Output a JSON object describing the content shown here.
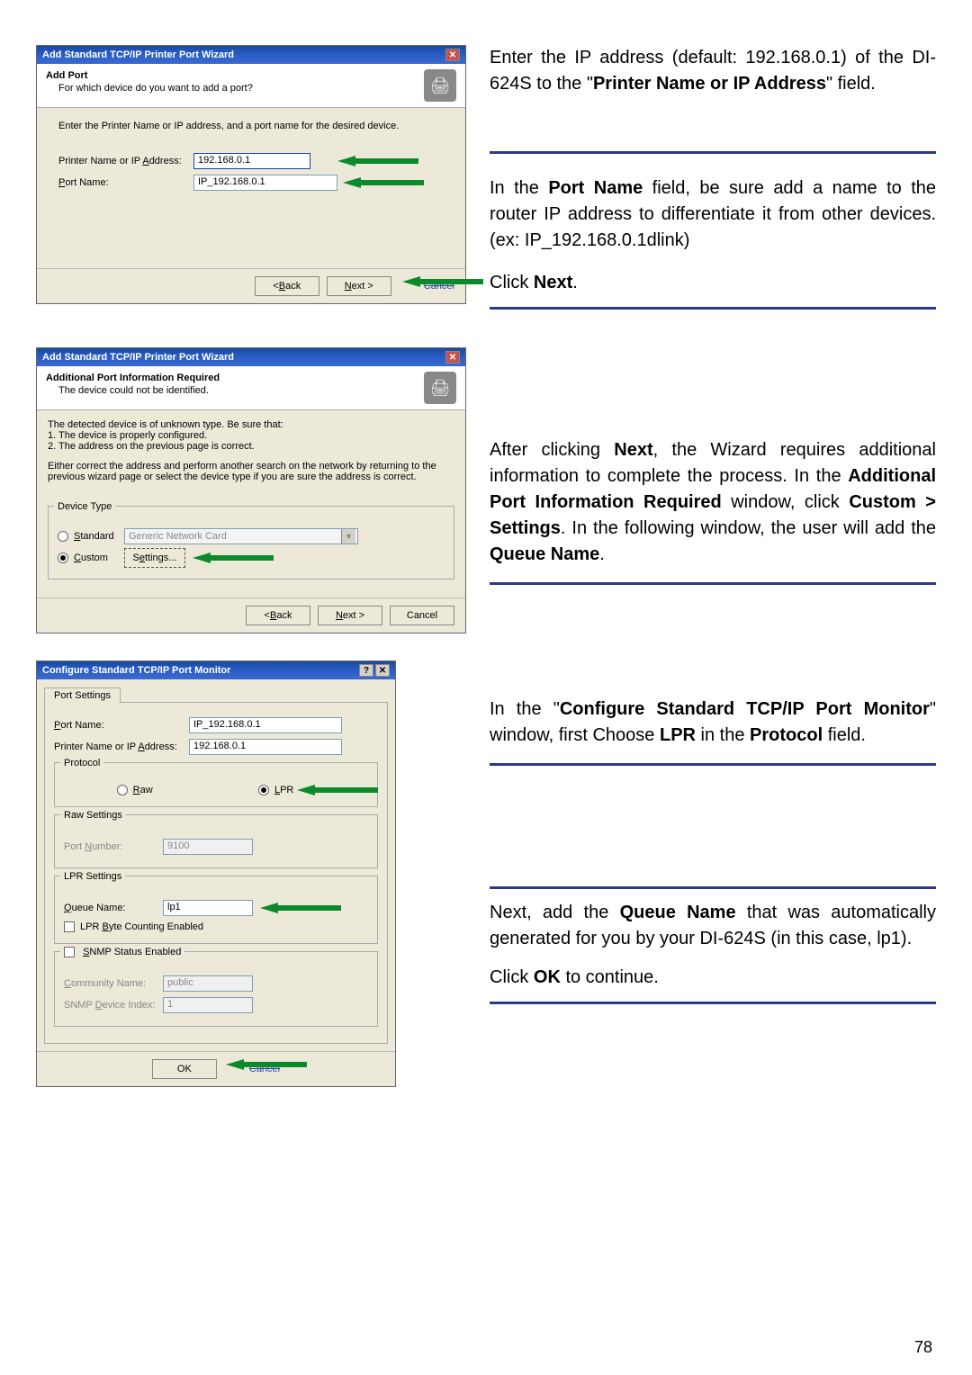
{
  "dialogs": {
    "addPort": {
      "title": "Add Standard TCP/IP Printer Port Wizard",
      "heading": "Add Port",
      "sub": "For which device do you want to add a port?",
      "instruction": "Enter the Printer Name or IP address, and a port name for the desired device.",
      "field1Label": "Printer Name or IP Address:",
      "field1Value": "192.168.0.1",
      "field2Label": "Port Name:",
      "field2Value": "IP_192.168.0.1",
      "backBtn": "< Back",
      "nextBtn": "Next >",
      "cancelBtn": "Cancel"
    },
    "additional": {
      "title": "Add Standard TCP/IP Printer Port Wizard",
      "heading": "Additional Port Information Required",
      "sub": "The device could not be identified.",
      "body1": "The detected device is of unknown type.  Be sure that:",
      "body2": "1. The device is properly configured.",
      "body3": "2.  The address on the previous page is correct.",
      "body4": "Either correct the address and perform another search on the network by returning to the previous wizard page or select the device type if you are sure the address is correct.",
      "deviceTypeLegend": "Device Type",
      "standardLabel": "Standard",
      "standardValue": "Generic Network Card",
      "customLabel": "Custom",
      "settingsBtn": "Settings...",
      "backBtn": "< Back",
      "nextBtn": "Next >",
      "cancelBtn": "Cancel"
    },
    "configure": {
      "title": "Configure Standard TCP/IP Port Monitor",
      "tab": "Port Settings",
      "portNameLabel": "Port Name:",
      "portNameValue": "IP_192.168.0.1",
      "printerLabel": "Printer Name or IP Address:",
      "printerValue": "192.168.0.1",
      "protocolLegend": "Protocol",
      "rawLabel": "Raw",
      "lprLabel": "LPR",
      "rawSettingsLegend": "Raw Settings",
      "portNumberLabel": "Port Number:",
      "portNumberValue": "9100",
      "lprSettingsLegend": "LPR Settings",
      "queueLabel": "Queue Name:",
      "queueValue": "lp1",
      "lprByteLabel": "LPR Byte Counting Enabled",
      "snmpLegend": "SNMP Status Enabled",
      "communityLabel": "Community Name:",
      "communityValue": "public",
      "snmpIndexLabel": "SNMP Device Index:",
      "snmpIndexValue": "1",
      "okBtn": "OK",
      "cancelBtn": "Cancel"
    }
  },
  "text": {
    "p1a": "Enter the IP address (default: 192.168.0.1) of the DI-624S to the \"",
    "p1b": "Printer Name or IP Address",
    "p1c": "\" field.",
    "p2a": "In the ",
    "p2b": "Port Name",
    "p2c": " field, be sure add a name to the router IP address to differentiate it from other devices.(ex: IP_192.168.0.1dlink)",
    "p3a": "Click ",
    "p3b": "Next",
    "p3c": ".",
    "p4a": "After clicking ",
    "p4b": "Next",
    "p4c": ", the Wizard requires additional information to complete the process. In the ",
    "p4d": "Additional Port Information Required",
    "p4e": " window, click ",
    "p4f": "Custom > Settings",
    "p4g": ". In the following window, the user will add the ",
    "p4h": "Queue Name",
    "p4i": ".",
    "p5a": "In the \"",
    "p5b": "Configure Standard TCP/IP Port Monitor",
    "p5c": "\" window, first Choose ",
    "p5d": "LPR",
    "p5e": " in the ",
    "p5f": "Protocol",
    "p5g": " field.",
    "p6a": "Next, add the ",
    "p6b": "Queue Name",
    "p6c": " that was automatically generated for you by your DI-624S (in this case, lp1).",
    "p7a": "Click ",
    "p7b": "OK",
    "p7c": " to continue.",
    "pageNum": "78"
  }
}
